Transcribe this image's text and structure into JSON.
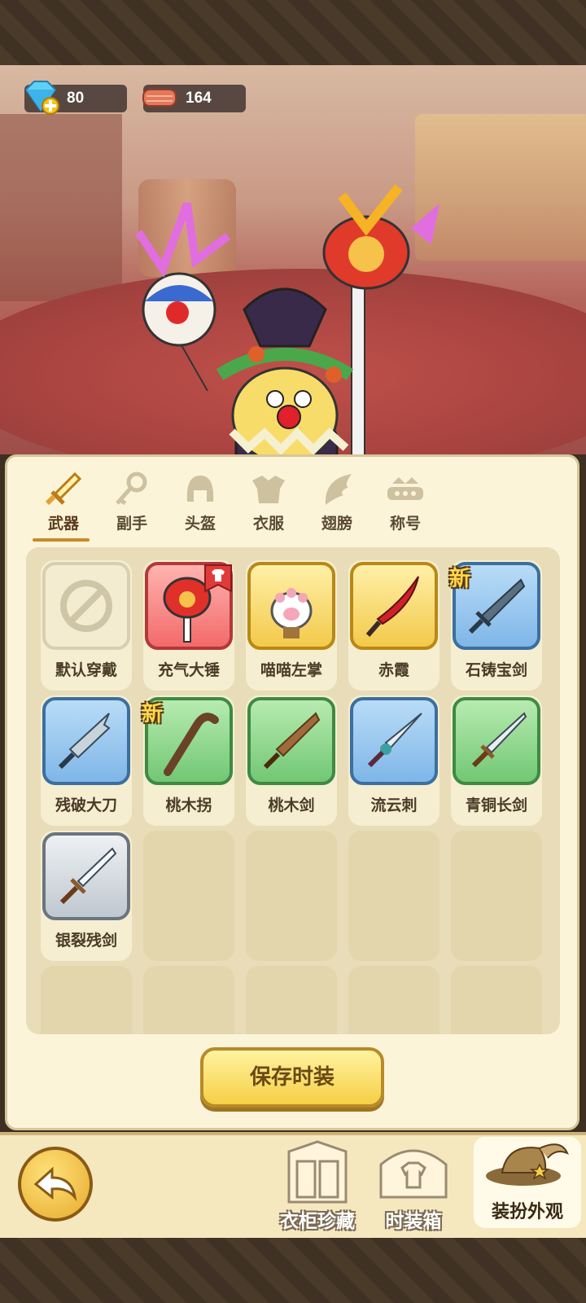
{
  "currencies": [
    {
      "name": "diamond",
      "value": "80",
      "icon": "diamond-plus-icon"
    },
    {
      "name": "material",
      "value": "164",
      "icon": "cloth-roll-icon"
    }
  ],
  "tabs": [
    {
      "id": "weapon",
      "label": "武器",
      "icon": "sword-icon",
      "active": true
    },
    {
      "id": "offhand",
      "label": "副手",
      "icon": "key-icon",
      "active": false
    },
    {
      "id": "helmet",
      "label": "头盔",
      "icon": "helmet-icon",
      "active": false
    },
    {
      "id": "clothes",
      "label": "衣服",
      "icon": "armor-icon",
      "active": false
    },
    {
      "id": "wings",
      "label": "翅膀",
      "icon": "wing-icon",
      "active": false
    },
    {
      "id": "title",
      "label": "称号",
      "icon": "crown-banner-icon",
      "active": false
    }
  ],
  "items": [
    {
      "label": "默认穿戴",
      "rarity": "default",
      "icon": "none-icon"
    },
    {
      "label": "充气大锤",
      "rarity": "red",
      "icon": "inflatable-hammer-icon",
      "equipped": true
    },
    {
      "label": "喵喵左掌",
      "rarity": "gold",
      "icon": "cat-paw-icon"
    },
    {
      "label": "赤霞",
      "rarity": "gold",
      "icon": "red-blade-icon"
    },
    {
      "label": "石铸宝剑",
      "rarity": "blue",
      "icon": "stone-sword-icon",
      "new": "新"
    },
    {
      "label": "残破大刀",
      "rarity": "blue",
      "icon": "broken-broadsword-icon"
    },
    {
      "label": "桃木拐",
      "rarity": "green",
      "icon": "peach-cane-icon",
      "new": "新"
    },
    {
      "label": "桃木剑",
      "rarity": "green",
      "icon": "peach-sword-icon"
    },
    {
      "label": "流云刺",
      "rarity": "blue",
      "icon": "cloud-dagger-icon"
    },
    {
      "label": "青铜长剑",
      "rarity": "green",
      "icon": "bronze-longsword-icon"
    },
    {
      "label": "银裂残剑",
      "rarity": "gray",
      "icon": "silver-cracked-sword-icon"
    }
  ],
  "save_button": "保存时装",
  "bottom_nav": [
    {
      "label": "衣柜珍藏",
      "icon": "wardrobe-icon"
    },
    {
      "label": "时装箱",
      "icon": "fashion-box-icon"
    },
    {
      "label": "装扮外观",
      "icon": "feather-hat-icon",
      "active": true
    }
  ]
}
